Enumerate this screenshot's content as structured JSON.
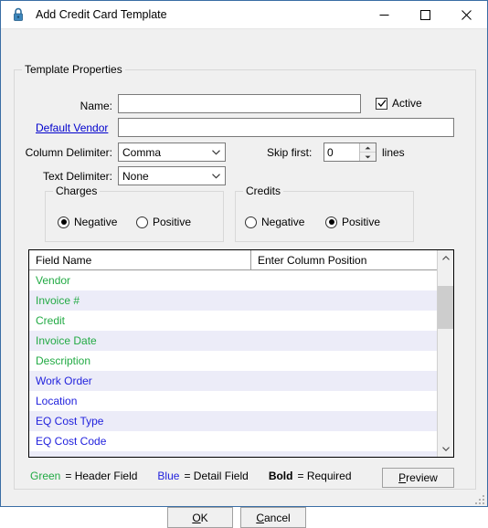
{
  "window": {
    "title": "Add Credit Card Template",
    "icon": "lock-icon",
    "minimize_label": "Minimize",
    "maximize_label": "Maximize",
    "close_label": "Close"
  },
  "template_properties": {
    "group_title": "Template Properties",
    "name_label": "Name:",
    "name_value": "",
    "name_placeholder": "",
    "active_label": "Active",
    "active_checked": true,
    "default_vendor_label": "Default Vendor",
    "default_vendor_value": "",
    "column_delimiter_label": "Column Delimiter:",
    "column_delimiter_value": "Comma",
    "text_delimiter_label": "Text Delimiter:",
    "text_delimiter_value": "None",
    "skip_first_label": "Skip first:",
    "skip_first_value": "0",
    "lines_label": "lines"
  },
  "charges": {
    "group_title": "Charges",
    "options": [
      {
        "label": "Negative",
        "selected": true
      },
      {
        "label": "Positive",
        "selected": false
      }
    ]
  },
  "credits": {
    "group_title": "Credits",
    "options": [
      {
        "label": "Negative",
        "selected": false
      },
      {
        "label": "Positive",
        "selected": true
      }
    ]
  },
  "grid": {
    "columns": [
      "Field Name",
      "Enter Column Position"
    ],
    "rows": [
      {
        "name": "Vendor",
        "position": "",
        "kind": "header",
        "required": false
      },
      {
        "name": "Invoice #",
        "position": "",
        "kind": "header",
        "required": false
      },
      {
        "name": "Credit",
        "position": "",
        "kind": "header",
        "required": false
      },
      {
        "name": "Invoice Date",
        "position": "",
        "kind": "header",
        "required": false
      },
      {
        "name": "Description",
        "position": "",
        "kind": "header",
        "required": false
      },
      {
        "name": "Work Order",
        "position": "",
        "kind": "detail",
        "required": false
      },
      {
        "name": "Location",
        "position": "",
        "kind": "detail",
        "required": false
      },
      {
        "name": "EQ Cost Type",
        "position": "",
        "kind": "detail",
        "required": false
      },
      {
        "name": "EQ Cost Code",
        "position": "",
        "kind": "detail",
        "required": false
      },
      {
        "name": "",
        "position": "",
        "kind": "detail",
        "required": false
      }
    ]
  },
  "legend": {
    "green_word": "Green",
    "green_text": "= Header Field",
    "blue_word": "Blue",
    "blue_text": "= Detail Field",
    "bold_word": "Bold",
    "bold_text": "= Required"
  },
  "buttons": {
    "preview": "Preview",
    "preview_accel": "P",
    "preview_rest": "review",
    "ok": "OK",
    "ok_accel": "O",
    "ok_rest": "K",
    "cancel": "Cancel",
    "cancel_accel": "C",
    "cancel_rest": "ancel"
  },
  "colors": {
    "header_field": "#22aa44",
    "detail_field": "#2222dd",
    "link": "#0000cd",
    "window_border": "#3a6ea5",
    "dialog_bg": "#f0f0f0",
    "row_alt": "#ececf8"
  }
}
